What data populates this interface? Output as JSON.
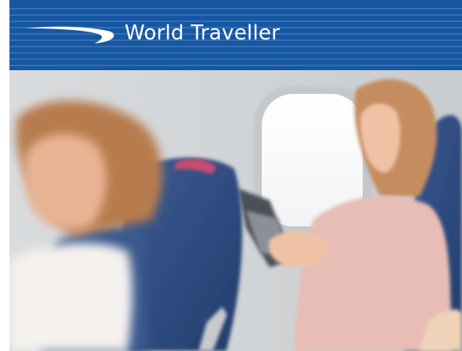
{
  "banner": {
    "title": "World Traveller",
    "background_color": "#1657a3",
    "logo": "speedmarque-ribbon-icon"
  },
  "photo": {
    "subject": "aircraft-cabin-passengers-image"
  }
}
